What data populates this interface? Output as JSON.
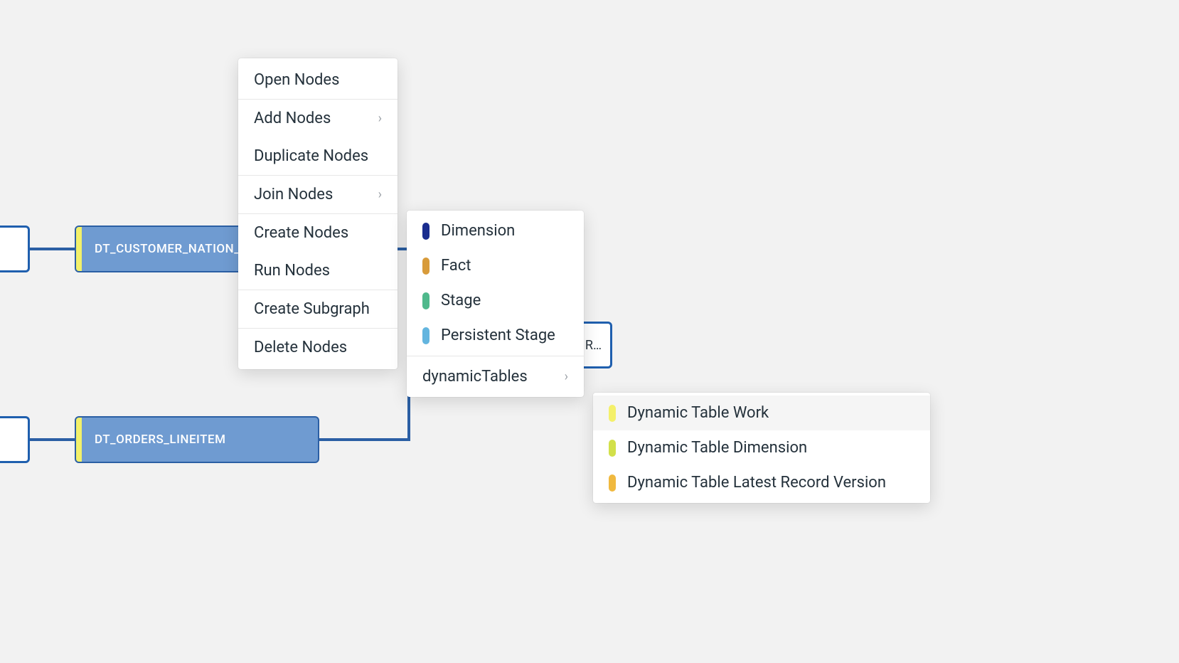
{
  "nodes": {
    "customer_nation": "DT_CUSTOMER_NATION_",
    "orders_lineitem": "DT_ORDERS_LINEITEM",
    "output_truncated": "R…"
  },
  "context_menu": {
    "open_nodes": "Open Nodes",
    "add_nodes": "Add Nodes",
    "duplicate_nodes": "Duplicate Nodes",
    "join_nodes": "Join Nodes",
    "create_nodes": "Create Nodes",
    "run_nodes": "Run Nodes",
    "create_subgraph": "Create Subgraph",
    "delete_nodes": "Delete Nodes"
  },
  "node_types_submenu": {
    "dimension": {
      "label": "Dimension",
      "color": "#1a2d8f"
    },
    "fact": {
      "label": "Fact",
      "color": "#d89b3a"
    },
    "stage": {
      "label": "Stage",
      "color": "#4fb98c"
    },
    "persistent_stage": {
      "label": "Persistent Stage",
      "color": "#63b5df"
    },
    "dynamic_tables": {
      "label": "dynamicTables"
    }
  },
  "dynamic_tables_submenu": {
    "work": {
      "label": "Dynamic Table Work",
      "color": "#f4f06a"
    },
    "dimension": {
      "label": "Dynamic Table Dimension",
      "color": "#d2e04a"
    },
    "latest_record": {
      "label": "Dynamic Table Latest Record Version",
      "color": "#f0b93f"
    }
  }
}
